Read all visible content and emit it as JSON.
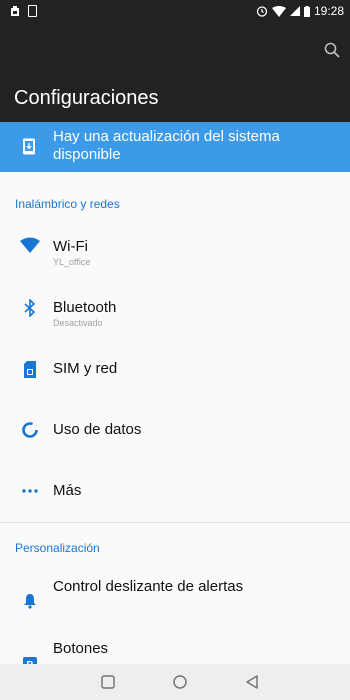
{
  "status_bar": {
    "time": "19:28",
    "icons": [
      "notification-icon",
      "sim-icon",
      "alarm-icon",
      "wifi-icon",
      "signal-icon",
      "battery-icon"
    ]
  },
  "app_bar": {
    "title": "Configuraciones",
    "search_icon": "search-icon"
  },
  "update_banner": {
    "text": "Hay una actualización del sistema disponible",
    "icon": "system-update-icon",
    "color": "#3d9ae9"
  },
  "sections": [
    {
      "header": "Inalámbrico y redes",
      "items": [
        {
          "label": "Wi-Fi",
          "subtitle": "YL_office",
          "icon": "wifi-icon"
        },
        {
          "label": "Bluetooth",
          "subtitle": "Desactivado",
          "icon": "bluetooth-icon"
        },
        {
          "label": "SIM y red",
          "subtitle": "",
          "icon": "sim-card-icon"
        },
        {
          "label": "Uso de datos",
          "subtitle": "",
          "icon": "data-usage-icon"
        },
        {
          "label": "Más",
          "subtitle": "",
          "icon": "more-icon"
        }
      ]
    },
    {
      "header": "Personalización",
      "items": [
        {
          "label": "Control deslizante de alertas",
          "subtitle": "",
          "icon": "alert-bell-icon"
        },
        {
          "label": "Botones",
          "subtitle": "",
          "icon": "buttons-icon"
        }
      ]
    }
  ],
  "nav_bar": {
    "icons": [
      "recents-icon",
      "home-icon",
      "back-icon"
    ]
  },
  "colors": {
    "accent": "#1976d2",
    "app_bar": "#222222",
    "banner": "#3d9ae9"
  }
}
